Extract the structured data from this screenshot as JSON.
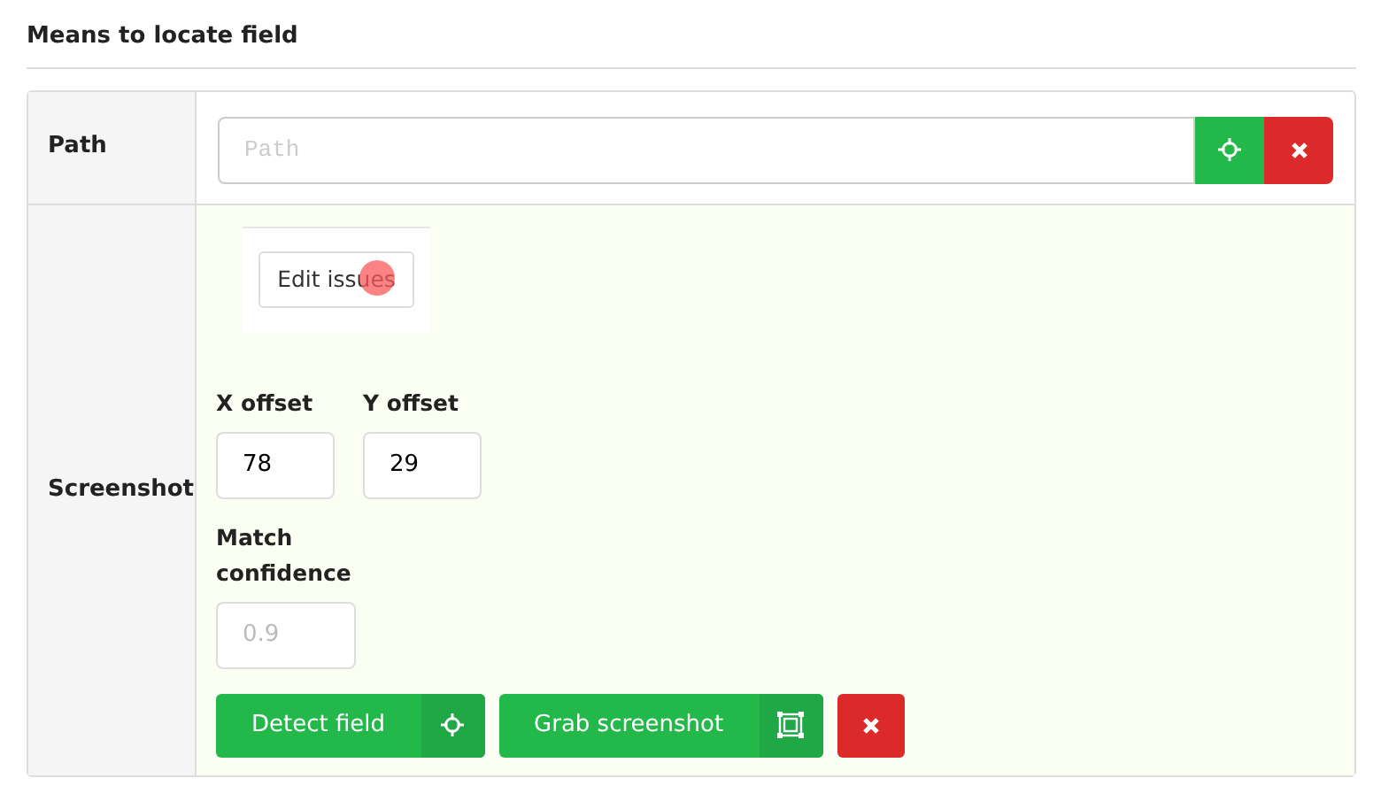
{
  "section_title": "Means to locate field",
  "path_row": {
    "label": "Path",
    "field": {
      "placeholder": "Path"
    }
  },
  "screenshot_row": {
    "label": "Screenshot",
    "thumbnail": {
      "button_label": "Edit issues"
    },
    "x_offset": {
      "label": "X offset",
      "value": "78"
    },
    "y_offset": {
      "label": "Y offset",
      "value": "29"
    },
    "match_confidence": {
      "label": "Match confidence",
      "placeholder": "0.9"
    },
    "buttons": [
      {
        "kind": "detect",
        "label": "Detect field"
      },
      {
        "kind": "grab",
        "label": "Grab screenshot"
      },
      {
        "kind": "clear"
      }
    ]
  }
}
